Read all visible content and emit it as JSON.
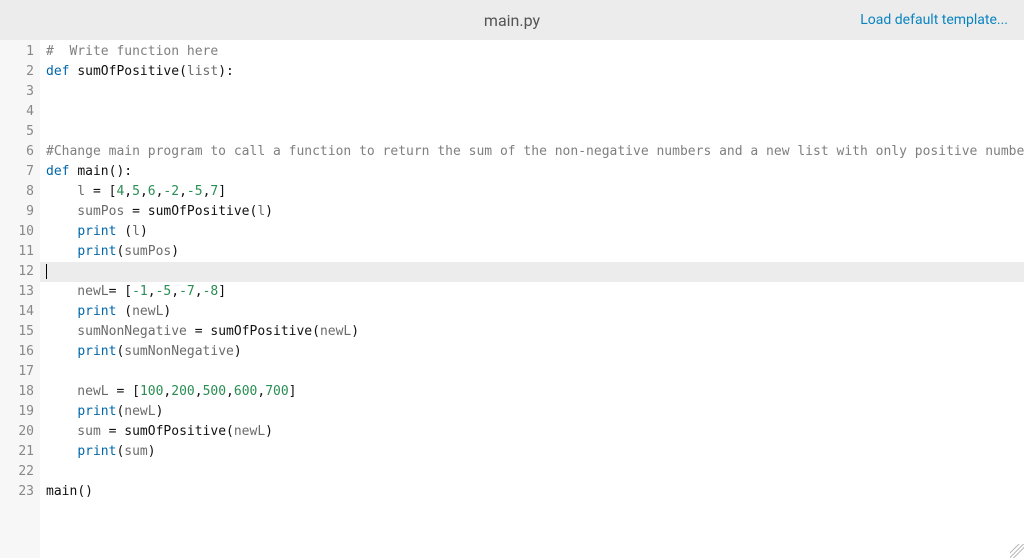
{
  "header": {
    "title": "main.py",
    "load_link": "Load default template..."
  },
  "editor": {
    "active_line": 12,
    "lines": [
      {
        "n": 1,
        "tokens": [
          {
            "t": "# ",
            "c": "tok-comment"
          },
          {
            "t": " Write function here",
            "c": "tok-comment"
          }
        ]
      },
      {
        "n": 2,
        "tokens": [
          {
            "t": "def ",
            "c": "tok-keyword"
          },
          {
            "t": "sumOfPositive",
            "c": "tok-func"
          },
          {
            "t": "(",
            "c": "tok-punct"
          },
          {
            "t": "list",
            "c": "tok-ident"
          },
          {
            "t": "):",
            "c": "tok-punct"
          }
        ]
      },
      {
        "n": 3,
        "tokens": []
      },
      {
        "n": 4,
        "tokens": []
      },
      {
        "n": 5,
        "tokens": []
      },
      {
        "n": 6,
        "tokens": [
          {
            "t": "#Change main program to call a function to return the sum of the non-negative numbers and a new list with only positive numbe",
            "c": "tok-comment"
          }
        ]
      },
      {
        "n": 7,
        "tokens": [
          {
            "t": "def ",
            "c": "tok-keyword"
          },
          {
            "t": "main",
            "c": "tok-func"
          },
          {
            "t": "():",
            "c": "tok-punct"
          }
        ]
      },
      {
        "n": 8,
        "tokens": [
          {
            "t": "    l ",
            "c": "tok-ident"
          },
          {
            "t": "= [",
            "c": "tok-punct"
          },
          {
            "t": "4",
            "c": "tok-num"
          },
          {
            "t": ",",
            "c": "tok-punct"
          },
          {
            "t": "5",
            "c": "tok-num"
          },
          {
            "t": ",",
            "c": "tok-punct"
          },
          {
            "t": "6",
            "c": "tok-num"
          },
          {
            "t": ",",
            "c": "tok-punct"
          },
          {
            "t": "-2",
            "c": "tok-num"
          },
          {
            "t": ",",
            "c": "tok-punct"
          },
          {
            "t": "-5",
            "c": "tok-num"
          },
          {
            "t": ",",
            "c": "tok-punct"
          },
          {
            "t": "7",
            "c": "tok-num"
          },
          {
            "t": "]",
            "c": "tok-punct"
          }
        ]
      },
      {
        "n": 9,
        "tokens": [
          {
            "t": "    sumPos ",
            "c": "tok-ident"
          },
          {
            "t": "= ",
            "c": "tok-punct"
          },
          {
            "t": "sumOfPositive",
            "c": "tok-func"
          },
          {
            "t": "(",
            "c": "tok-punct"
          },
          {
            "t": "l",
            "c": "tok-ident"
          },
          {
            "t": ")",
            "c": "tok-punct"
          }
        ]
      },
      {
        "n": 10,
        "tokens": [
          {
            "t": "    ",
            "c": ""
          },
          {
            "t": "print",
            "c": "tok-builtin"
          },
          {
            "t": " (",
            "c": "tok-punct"
          },
          {
            "t": "l",
            "c": "tok-ident"
          },
          {
            "t": ")",
            "c": "tok-punct"
          }
        ]
      },
      {
        "n": 11,
        "tokens": [
          {
            "t": "    ",
            "c": ""
          },
          {
            "t": "print",
            "c": "tok-builtin"
          },
          {
            "t": "(",
            "c": "tok-punct"
          },
          {
            "t": "sumPos",
            "c": "tok-ident"
          },
          {
            "t": ")",
            "c": "tok-punct"
          }
        ]
      },
      {
        "n": 12,
        "tokens": []
      },
      {
        "n": 13,
        "tokens": [
          {
            "t": "    newL",
            "c": "tok-ident"
          },
          {
            "t": "= [",
            "c": "tok-punct"
          },
          {
            "t": "-1",
            "c": "tok-num"
          },
          {
            "t": ",",
            "c": "tok-punct"
          },
          {
            "t": "-5",
            "c": "tok-num"
          },
          {
            "t": ",",
            "c": "tok-punct"
          },
          {
            "t": "-7",
            "c": "tok-num"
          },
          {
            "t": ",",
            "c": "tok-punct"
          },
          {
            "t": "-8",
            "c": "tok-num"
          },
          {
            "t": "]",
            "c": "tok-punct"
          }
        ]
      },
      {
        "n": 14,
        "tokens": [
          {
            "t": "    ",
            "c": ""
          },
          {
            "t": "print",
            "c": "tok-builtin"
          },
          {
            "t": " (",
            "c": "tok-punct"
          },
          {
            "t": "newL",
            "c": "tok-ident"
          },
          {
            "t": ")",
            "c": "tok-punct"
          }
        ]
      },
      {
        "n": 15,
        "tokens": [
          {
            "t": "    sumNonNegative ",
            "c": "tok-ident"
          },
          {
            "t": "= ",
            "c": "tok-punct"
          },
          {
            "t": "sumOfPositive",
            "c": "tok-func"
          },
          {
            "t": "(",
            "c": "tok-punct"
          },
          {
            "t": "newL",
            "c": "tok-ident"
          },
          {
            "t": ")",
            "c": "tok-punct"
          }
        ]
      },
      {
        "n": 16,
        "tokens": [
          {
            "t": "    ",
            "c": ""
          },
          {
            "t": "print",
            "c": "tok-builtin"
          },
          {
            "t": "(",
            "c": "tok-punct"
          },
          {
            "t": "sumNonNegative",
            "c": "tok-ident"
          },
          {
            "t": ")",
            "c": "tok-punct"
          }
        ]
      },
      {
        "n": 17,
        "tokens": []
      },
      {
        "n": 18,
        "tokens": [
          {
            "t": "    newL ",
            "c": "tok-ident"
          },
          {
            "t": "= [",
            "c": "tok-punct"
          },
          {
            "t": "100",
            "c": "tok-num"
          },
          {
            "t": ",",
            "c": "tok-punct"
          },
          {
            "t": "200",
            "c": "tok-num"
          },
          {
            "t": ",",
            "c": "tok-punct"
          },
          {
            "t": "500",
            "c": "tok-num"
          },
          {
            "t": ",",
            "c": "tok-punct"
          },
          {
            "t": "600",
            "c": "tok-num"
          },
          {
            "t": ",",
            "c": "tok-punct"
          },
          {
            "t": "700",
            "c": "tok-num"
          },
          {
            "t": "]",
            "c": "tok-punct"
          }
        ]
      },
      {
        "n": 19,
        "tokens": [
          {
            "t": "    ",
            "c": ""
          },
          {
            "t": "print",
            "c": "tok-builtin"
          },
          {
            "t": "(",
            "c": "tok-punct"
          },
          {
            "t": "newL",
            "c": "tok-ident"
          },
          {
            "t": ")",
            "c": "tok-punct"
          }
        ]
      },
      {
        "n": 20,
        "tokens": [
          {
            "t": "    sum ",
            "c": "tok-ident"
          },
          {
            "t": "= ",
            "c": "tok-punct"
          },
          {
            "t": "sumOfPositive",
            "c": "tok-func"
          },
          {
            "t": "(",
            "c": "tok-punct"
          },
          {
            "t": "newL",
            "c": "tok-ident"
          },
          {
            "t": ")",
            "c": "tok-punct"
          }
        ]
      },
      {
        "n": 21,
        "tokens": [
          {
            "t": "    ",
            "c": ""
          },
          {
            "t": "print",
            "c": "tok-builtin"
          },
          {
            "t": "(",
            "c": "tok-punct"
          },
          {
            "t": "sum",
            "c": "tok-ident"
          },
          {
            "t": ")",
            "c": "tok-punct"
          }
        ]
      },
      {
        "n": 22,
        "tokens": []
      },
      {
        "n": 23,
        "tokens": [
          {
            "t": "main",
            "c": "tok-func"
          },
          {
            "t": "()",
            "c": "tok-punct"
          }
        ]
      }
    ]
  }
}
